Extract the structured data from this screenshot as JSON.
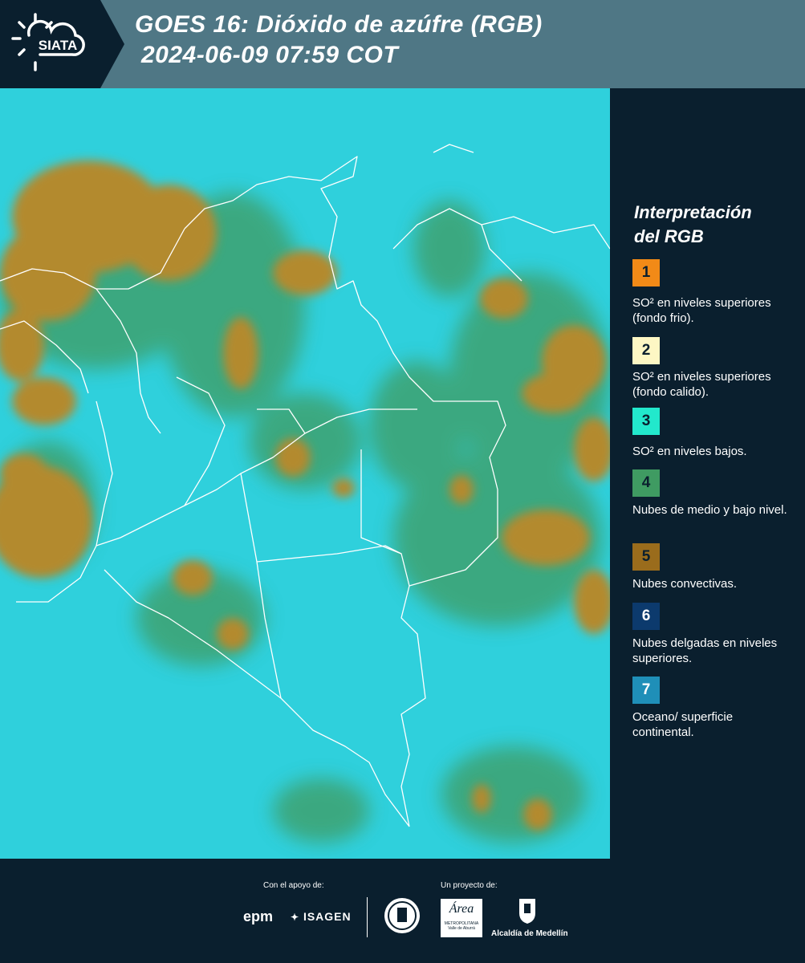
{
  "header": {
    "logo_text": "SIATA",
    "title_line1": "GOES 16: Dióxido de azúfre (RGB)",
    "title_line2": "2024-06-09 07:59 COT"
  },
  "legend": {
    "title_line1": "Interpretación",
    "title_line2": "del RGB",
    "items": [
      {
        "number": "1",
        "color": "#f28a17",
        "label": "SO² en niveles superiores (fondo frio)."
      },
      {
        "number": "2",
        "color": "#fdf7c4",
        "label": "SO² en niveles superiores (fondo calido)."
      },
      {
        "number": "3",
        "color": "#22e8cc",
        "label": "SO² en niveles bajos."
      },
      {
        "number": "4",
        "color": "#3f9b62",
        "label": "Nubes de medio y bajo nivel."
      },
      {
        "number": "5",
        "color": "#9a6c1c",
        "label": "Nubes convectivas."
      },
      {
        "number": "6",
        "color": "#0c3a6d",
        "label": "Nubes delgadas en niveles superiores."
      },
      {
        "number": "7",
        "color": "#1f8fb8",
        "label": "Oceano/ superficie continental."
      }
    ]
  },
  "footer": {
    "support_label": "Con el apoyo de:",
    "project_label": "Un proyecto de:",
    "sponsors": [
      "epm",
      "ISAGEN"
    ],
    "area_name": "Área",
    "area_sub1": "METROPOLITANA",
    "area_sub2": "Valle de Aburrá",
    "alcaldia": "Alcaldía de Medellín"
  },
  "map_colors": {
    "background": "#2fd0dc",
    "convective": "#b38a2e",
    "green_cloud": "#3f9b62",
    "borders": "#ffffff"
  }
}
